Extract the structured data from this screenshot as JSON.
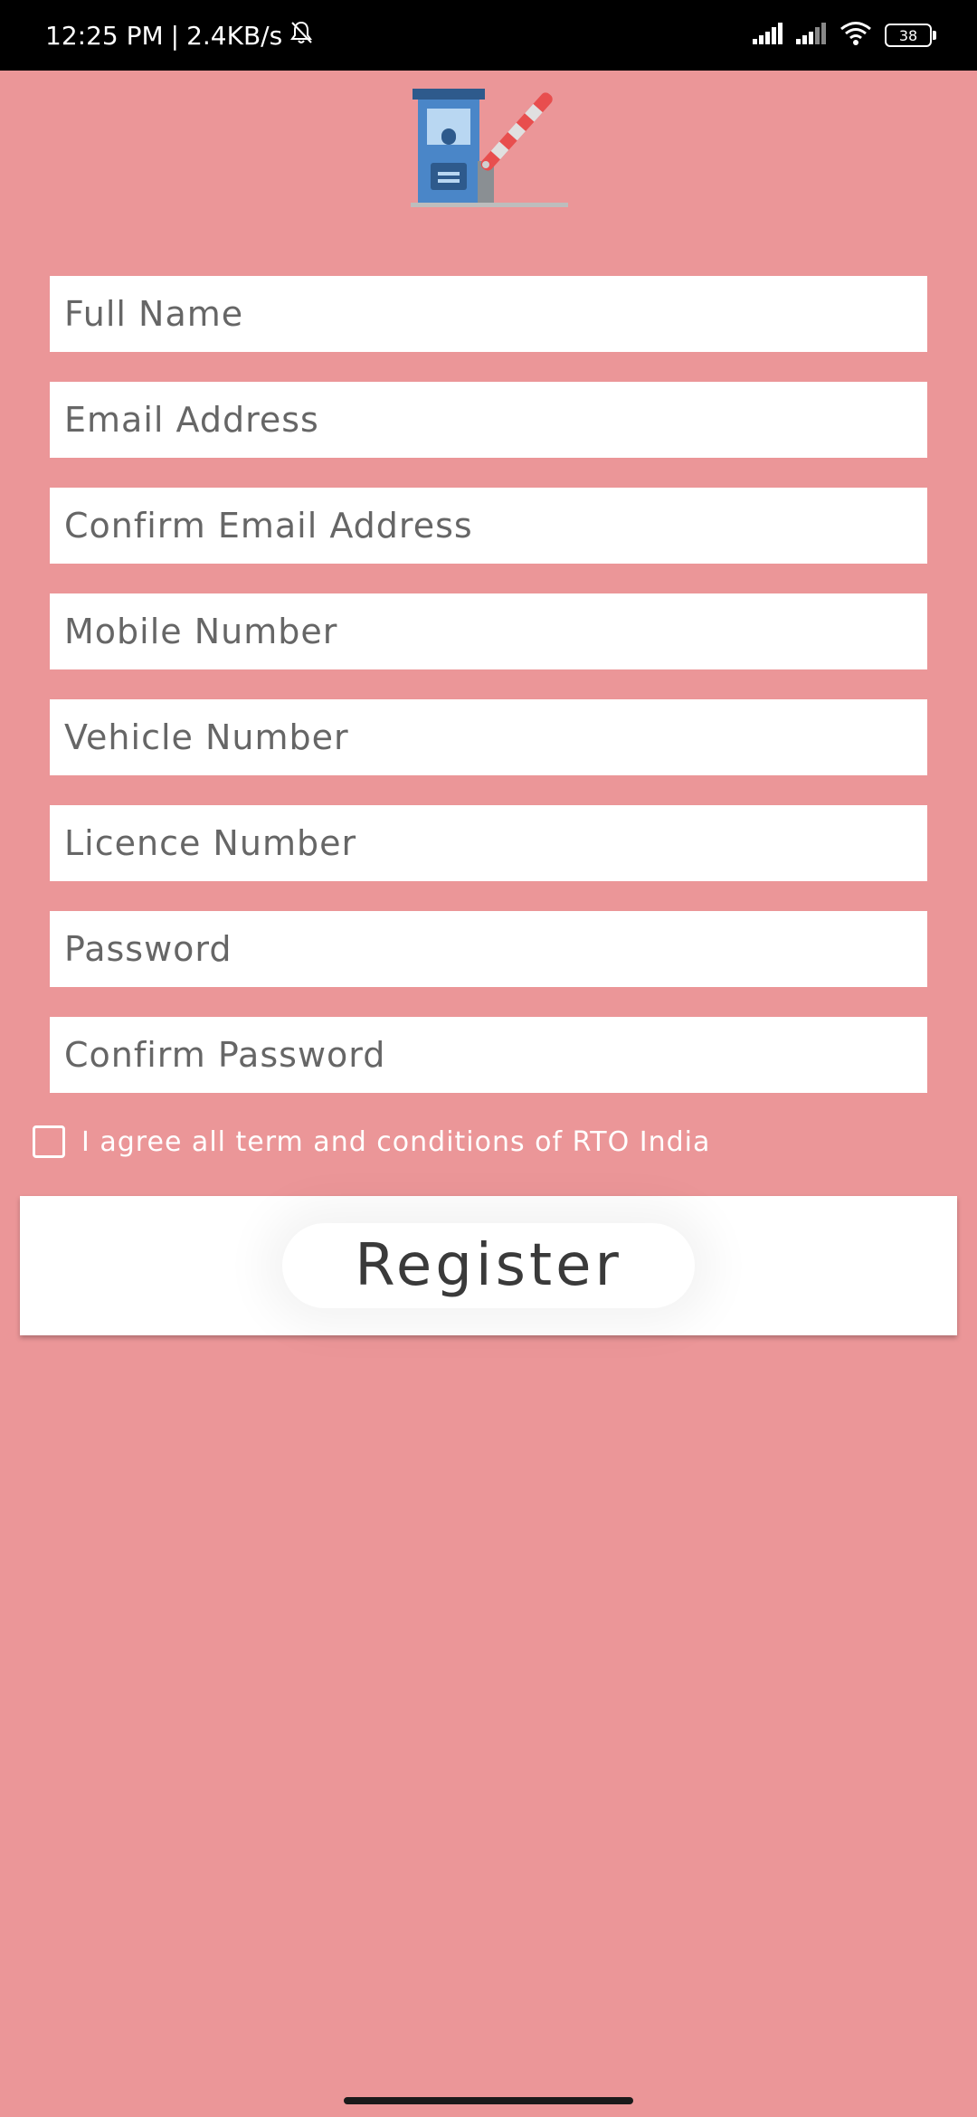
{
  "status_bar": {
    "time": "12:25 PM",
    "separator": "|",
    "net_speed": "2.4KB/s",
    "battery_level": "38",
    "icons": [
      "mute-bell-icon",
      "cellular-signal-icon",
      "cellular-signal-icon",
      "wifi-icon",
      "battery-icon"
    ]
  },
  "logo": {
    "icon": "toll-booth-barrier-icon"
  },
  "form": {
    "full_name_placeholder": "Full Name",
    "email_placeholder": "Email Address",
    "confirm_email_placeholder": "Confirm Email Address",
    "mobile_placeholder": "Mobile Number",
    "vehicle_placeholder": "Vehicle Number",
    "licence_placeholder": "Licence Number",
    "password_placeholder": "Password",
    "confirm_password_placeholder": "Confirm Password",
    "agree_label": "I agree all term and conditions of RTO India",
    "register_label": "Register"
  },
  "colors": {
    "background": "#EB9698",
    "status_bar": "#000000",
    "field_background": "#FFFFFF",
    "placeholder_text": "#666666",
    "button_text": "#3A3A3A"
  }
}
